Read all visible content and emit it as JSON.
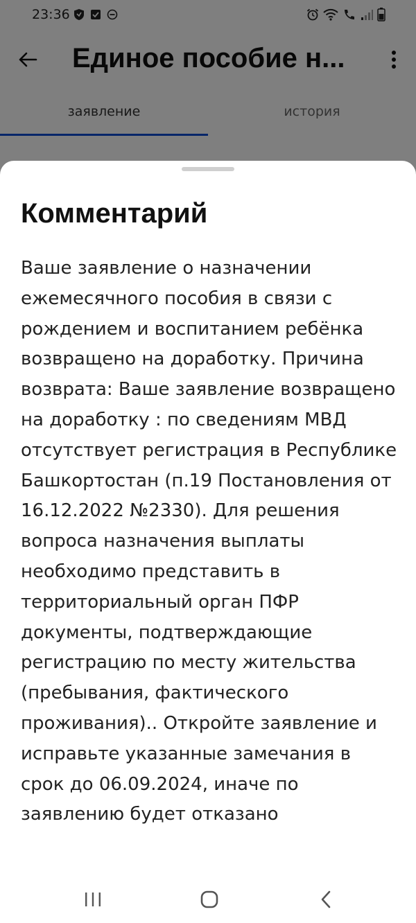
{
  "status_bar": {
    "time": "23:36",
    "left_icons": [
      "shield-icon",
      "check-box-icon",
      "do-not-disturb-icon"
    ],
    "right_icons": [
      "alarm-icon",
      "wifi-icon",
      "volte-call-icon",
      "signal-icon",
      "battery-icon"
    ]
  },
  "app_bar": {
    "title": "Единое пособие н...",
    "back_icon": "arrow-left-icon",
    "menu_icon": "more-vertical-icon"
  },
  "tabs": [
    {
      "label": "заявление",
      "active": true
    },
    {
      "label": "история",
      "active": false
    }
  ],
  "sheet": {
    "title": "Комментарий",
    "body": "Ваше заявление о назначении ежемесячного пособия в связи с рождением и воспитанием ребёнка возвращено на доработку. Причина возврата: Ваше заявление возвращено на доработку : по сведениям МВД отсутствует регистрация в Республике Башкортостан (п.19 Постановления от 16.12.2022 №2330). Для решения вопроса назначения выплаты необходимо представить в территориальный орган ПФР документы, подтверждающие регистрацию по месту жительства (пребывания, фактического проживания).. Откройте заявление и исправьте указанные замечания в срок до 06.09.2024, иначе по заявлению будет отказано"
  },
  "nav_bar": {
    "recents_icon": "recents-icon",
    "home_icon": "home-icon",
    "back_icon": "nav-back-icon"
  },
  "colors": {
    "accent": "#0d4cd3",
    "scrim": "rgba(0,0,0,0.5)",
    "text": "#222222"
  }
}
